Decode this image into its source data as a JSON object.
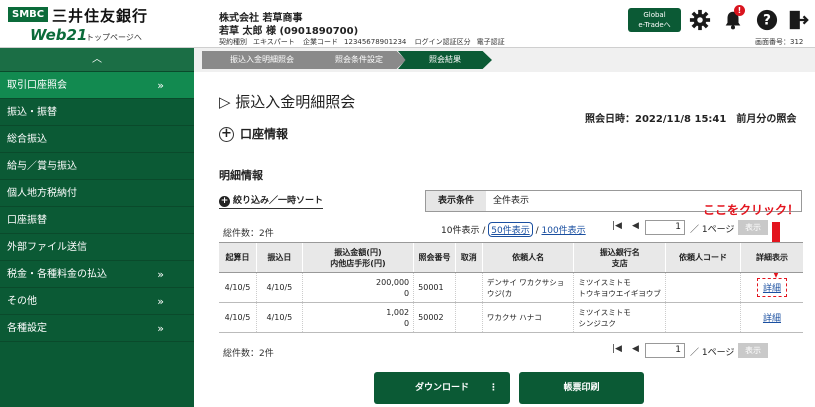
{
  "header": {
    "smbc": "SMBC",
    "brand": "三井住友銀行",
    "web21": "Web21",
    "toppage": "トップページへ",
    "company": "株式会社 若草商事",
    "user": "若草 太郎 様 (0901890700)",
    "info": [
      "契約種別",
      "エキスパート",
      "企業コード",
      "12345678901234",
      "ログイン認証区分",
      "電子認証"
    ],
    "global_btn_line1": "Global",
    "global_btn_line2": "e-Tradeへ",
    "badge": "!",
    "screen_no": "画面番号：312"
  },
  "sidebar": {
    "top": "︿",
    "items": [
      {
        "label": "取引口座照会",
        "arrow": "»"
      },
      {
        "label": "振込・振替",
        "arrow": ""
      },
      {
        "label": "総合振込",
        "arrow": ""
      },
      {
        "label": "給与／賞与振込",
        "arrow": ""
      },
      {
        "label": "個人地方税納付",
        "arrow": ""
      },
      {
        "label": "口座振替",
        "arrow": ""
      },
      {
        "label": "外部ファイル送信",
        "arrow": ""
      },
      {
        "label": "税金・各種料金の払込",
        "arrow": "»"
      },
      {
        "label": "その他",
        "arrow": "»"
      },
      {
        "label": "各種設定",
        "arrow": "»"
      }
    ]
  },
  "steps": [
    "振込入金明細照会",
    "照会条件設定",
    "照会結果"
  ],
  "main": {
    "title": "▷ 振込入金明細照会",
    "inquiry_date": "照会日時：2022/11/8 15:41　前月分の照会",
    "account_section": "口座情報",
    "detail_title": "明細情報",
    "filter": "絞り込み／一時ソート",
    "cond_label": "表示条件",
    "cond_value": "全件表示",
    "total": "総件数：2件",
    "perpage": {
      "p10": "10件表示",
      "sep": "/",
      "p50": "50件表示",
      "p100": "100件表示"
    },
    "pager": {
      "page": "1",
      "text": "／ 1ページ",
      "disp": "表示"
    },
    "click_note": "ここをクリック！"
  },
  "table": {
    "headers": [
      "起算日",
      "振込日",
      "振込金額(円)\n内他店手形(円)",
      "照会番号",
      "取消",
      "依頼人名",
      "振込銀行名\n支店",
      "依頼人コード",
      "詳細表示"
    ],
    "rows": [
      {
        "kisan": "4/10/5",
        "furikomi": "4/10/5",
        "amount": "200,000",
        "tegata": "0",
        "no": "50001",
        "torikeshi": "",
        "irai": "デンサイ ワカクサショウジ(カ",
        "bank": "ミツイスミトモ",
        "branch": "トウキヨウエイギヨウブ",
        "code": "",
        "detail": "詳細"
      },
      {
        "kisan": "4/10/5",
        "furikomi": "4/10/5",
        "amount": "1,002",
        "tegata": "0",
        "no": "50002",
        "torikeshi": "",
        "irai": "ワカクサ ハナコ",
        "bank": "ミツイスミトモ",
        "branch": "シンジユク",
        "code": "",
        "detail": "詳細"
      }
    ]
  },
  "buttons": {
    "download": "ダウンロード",
    "more": "⋮",
    "print": "帳票印刷"
  },
  "colors": {
    "brand_green": "#0b5a35",
    "active_green": "#128a50",
    "alert_red": "#e3141e",
    "link_blue": "#1a4fa0"
  }
}
